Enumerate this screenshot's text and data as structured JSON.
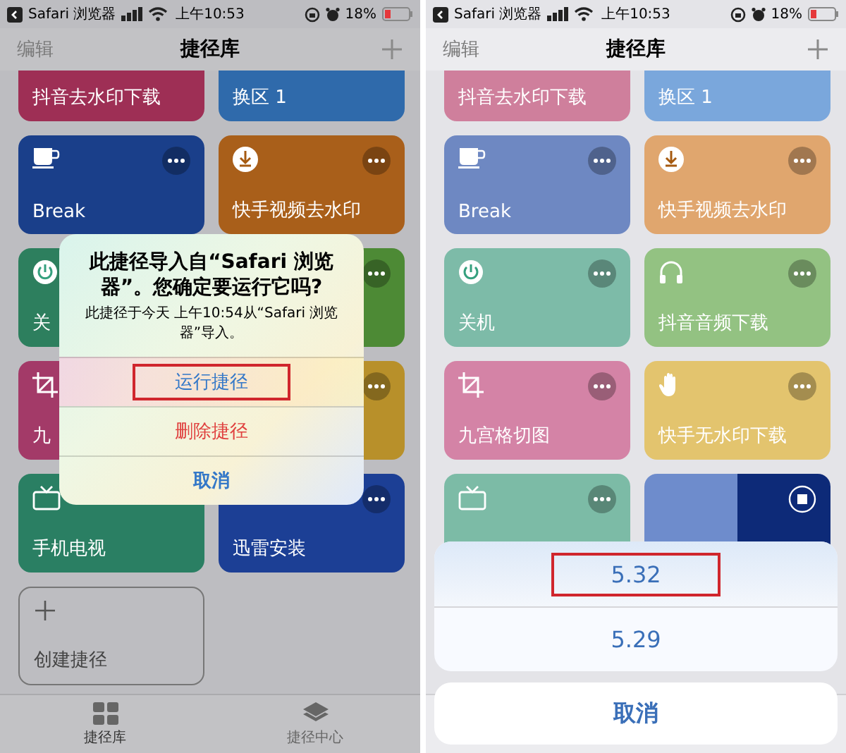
{
  "phones": [
    {
      "status_bar": {
        "back_app": "Safari 浏览器",
        "time": "上午10:53",
        "battery": "18%"
      },
      "nav": {
        "left": "编辑",
        "title": "捷径库"
      },
      "shortcuts": [
        {
          "kind": "cut",
          "label": "抖音去水印下载",
          "color": "#9e2f55"
        },
        {
          "kind": "cut",
          "label": "换区 1",
          "color": "#2f6aab"
        },
        {
          "kind": "full",
          "label": "Break",
          "color": "#1a3f8a",
          "icon_shown": true,
          "running": false
        },
        {
          "kind": "full",
          "label": "快手视频去水印",
          "color": "#a95f1a",
          "icon_shown": true,
          "running": false
        },
        {
          "kind": "full",
          "label": "关",
          "color": "#2d7f5e",
          "icon_shown": true
        },
        {
          "kind": "full",
          "color": "#4d8a35",
          "icon_shown": false,
          "running": false
        },
        {
          "kind": "full",
          "label": "九",
          "color": "#a33a68",
          "icon_shown": true
        },
        {
          "kind": "full",
          "color": "#b8902a",
          "icon_shown": false,
          "running": false
        },
        {
          "kind": "full",
          "label": "手机电视",
          "color": "#2a7f63",
          "icon_shown": true
        },
        {
          "kind": "full",
          "label": "迅雷安装",
          "color": "#1c3f95",
          "running": false
        }
      ],
      "create": {
        "label": "创建捷径"
      },
      "tab_bar": [
        {
          "label": "捷径库",
          "selected": true
        },
        {
          "label": "捷径中心",
          "selected": false
        }
      ],
      "dialog": {
        "title": "此捷径导入自“Safari 浏览器”。您确定要运行它吗?",
        "message": "此捷径于今天 上午10:54从“Safari 浏览器”导入。",
        "actions": [
          {
            "label": "运行捷径",
            "kind": "default",
            "highlighted": true
          },
          {
            "label": "删除捷径",
            "kind": "destructive",
            "highlighted": false
          },
          {
            "label": "取消",
            "kind": "cancel",
            "highlighted": false
          }
        ]
      }
    },
    {
      "status_bar": {
        "back_app": "Safari 浏览器",
        "time": "上午10:53",
        "battery": "18%"
      },
      "nav": {
        "left": "编辑",
        "title": "捷径库"
      },
      "shortcuts": [
        {
          "kind": "cut",
          "label": "抖音去水印下载",
          "color": "#cf7f9c"
        },
        {
          "kind": "cut",
          "label": "换区 1",
          "color": "#7aa7dc"
        },
        {
          "kind": "full",
          "label": "Break",
          "color": "#6e88c2",
          "icon_shown": true,
          "running": false
        },
        {
          "kind": "full",
          "label": "快手视频去水印",
          "color": "#e0a66e",
          "icon_shown": true,
          "running": false
        },
        {
          "kind": "full",
          "label": "关机",
          "color": "#7dbba8",
          "icon_shown": true,
          "running": false
        },
        {
          "kind": "full",
          "label": "抖音音频下载",
          "color": "#93c282",
          "icon_shown": true,
          "running": false
        },
        {
          "kind": "full",
          "label": "九宫格切图",
          "color": "#d483a6",
          "icon_shown": true,
          "running": false
        },
        {
          "kind": "full",
          "label": "快手无水印下载",
          "color": "#e3c46e",
          "icon_shown": true,
          "running": false
        },
        {
          "kind": "full",
          "color": "#7cbba6",
          "icon_shown": true,
          "running": false
        },
        {
          "kind": "full",
          "color": "#6e8ccc",
          "running": true
        }
      ],
      "sheet": {
        "options": [
          {
            "label": "5.32",
            "highlighted": true
          },
          {
            "label": "5.29",
            "highlighted": false
          }
        ],
        "cancel": "取消"
      }
    }
  ]
}
